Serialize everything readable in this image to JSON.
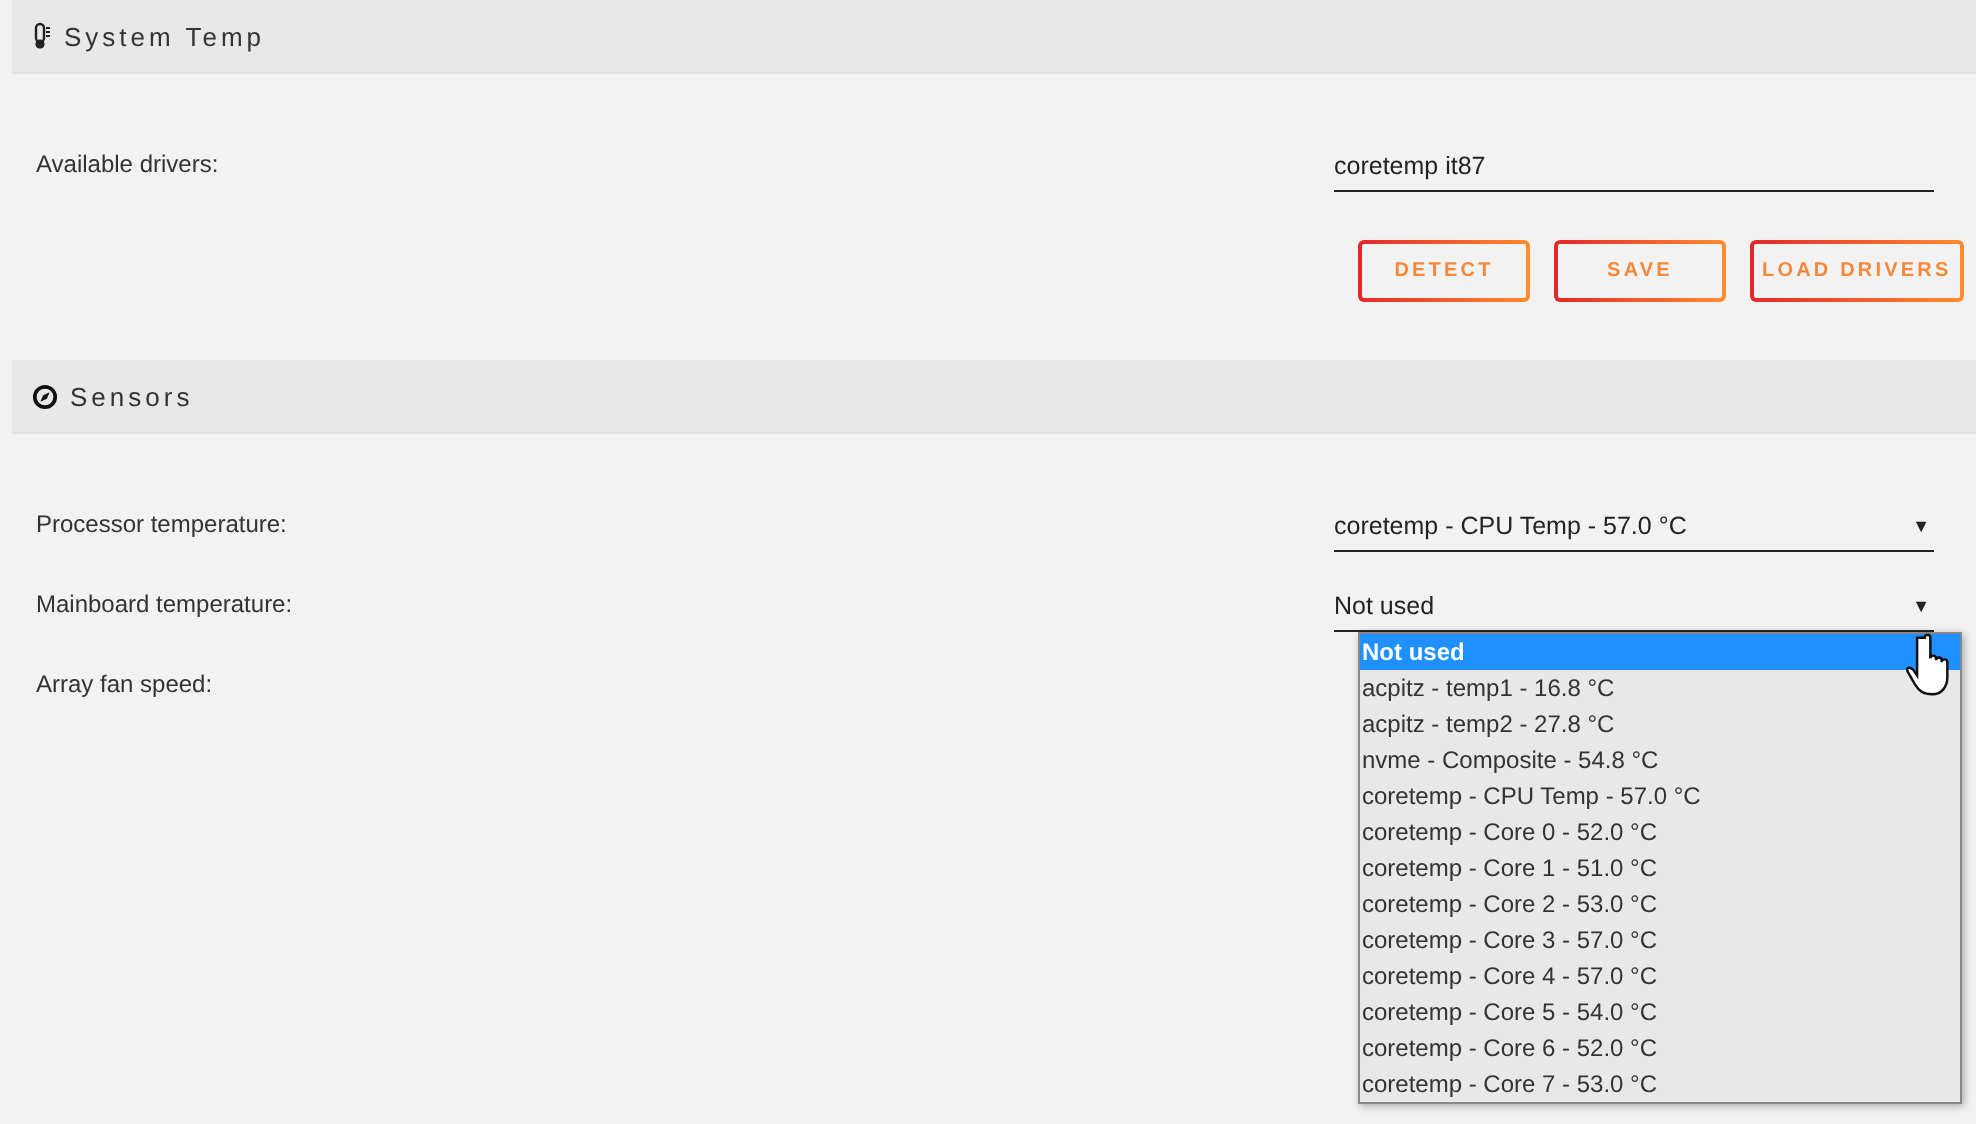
{
  "sections": [
    {
      "title": "System Temp"
    },
    {
      "title": "Sensors"
    }
  ],
  "drivers": {
    "label": "Available drivers:",
    "value": "coretemp it87"
  },
  "buttons": [
    "DETECT",
    "SAVE",
    "LOAD DRIVERS"
  ],
  "sensors": [
    {
      "label": "Processor temperature:",
      "value": "coretemp - CPU Temp - 57.0 °C",
      "arrow": "▼"
    },
    {
      "label": "Mainboard temperature:",
      "value": "Not used",
      "arrow": "▼",
      "options": [
        {
          "label": "Not used",
          "selected": true
        },
        {
          "label": "acpitz - temp1 - 16.8 °C",
          "selected": false
        },
        {
          "label": "acpitz - temp2 - 27.8 °C",
          "selected": false
        },
        {
          "label": "nvme - Composite - 54.8 °C",
          "selected": false
        },
        {
          "label": "coretemp - CPU Temp - 57.0 °C",
          "selected": false
        },
        {
          "label": "coretemp - Core 0 - 52.0 °C",
          "selected": false
        },
        {
          "label": "coretemp - Core 1 - 51.0 °C",
          "selected": false
        },
        {
          "label": "coretemp - Core 2 - 53.0 °C",
          "selected": false
        },
        {
          "label": "coretemp - Core 3 - 57.0 °C",
          "selected": false
        },
        {
          "label": "coretemp - Core 4 - 57.0 °C",
          "selected": false
        },
        {
          "label": "coretemp - Core 5 - 54.0 °C",
          "selected": false
        },
        {
          "label": "coretemp - Core 6 - 52.0 °C",
          "selected": false
        },
        {
          "label": "coretemp - Core 7 - 53.0 °C",
          "selected": false
        }
      ]
    },
    {
      "label": "Array fan speed:"
    }
  ]
}
